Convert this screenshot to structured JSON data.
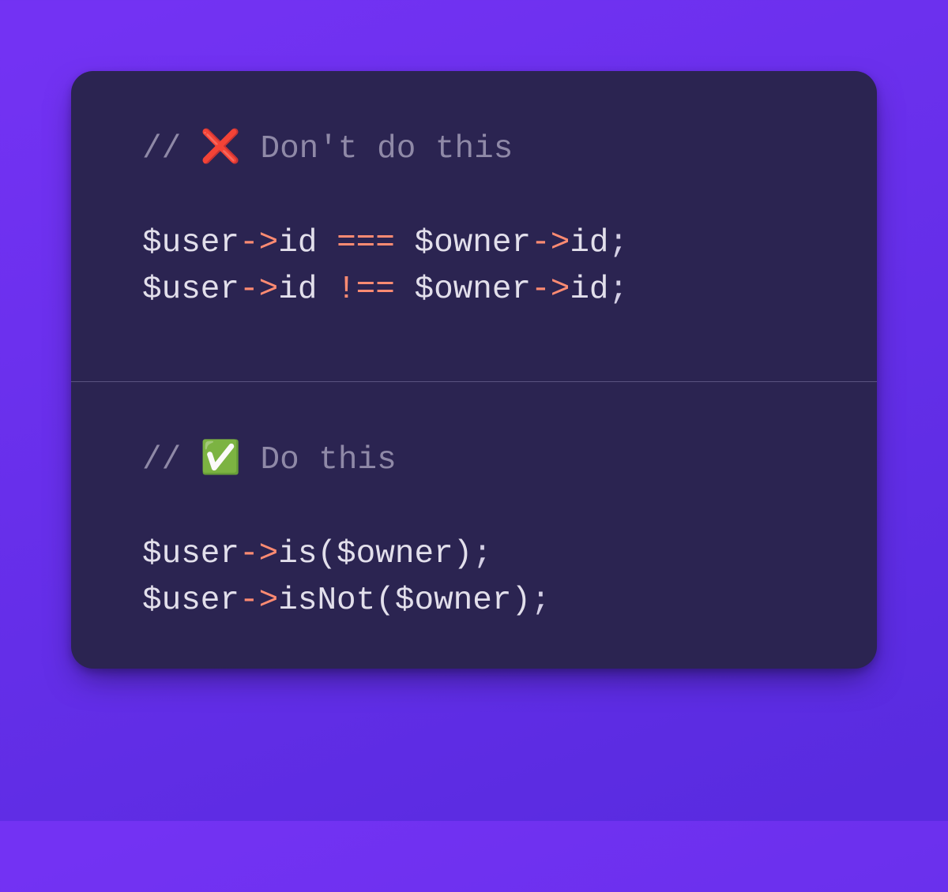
{
  "panels": [
    {
      "emoji": "❌",
      "comment_prefix": "// ",
      "comment_suffix": " Don't do this",
      "lines": [
        [
          {
            "cls": "default",
            "text": "$user"
          },
          {
            "cls": "op",
            "text": "->"
          },
          {
            "cls": "default",
            "text": "id "
          },
          {
            "cls": "op",
            "text": "==="
          },
          {
            "cls": "default",
            "text": " $owner"
          },
          {
            "cls": "op",
            "text": "->"
          },
          {
            "cls": "default",
            "text": "id"
          },
          {
            "cls": "punc",
            "text": ";"
          }
        ],
        [
          {
            "cls": "default",
            "text": "$user"
          },
          {
            "cls": "op",
            "text": "->"
          },
          {
            "cls": "default",
            "text": "id "
          },
          {
            "cls": "op",
            "text": "!=="
          },
          {
            "cls": "default",
            "text": " $owner"
          },
          {
            "cls": "op",
            "text": "->"
          },
          {
            "cls": "default",
            "text": "id"
          },
          {
            "cls": "punc",
            "text": ";"
          }
        ]
      ]
    },
    {
      "emoji": "✅",
      "comment_prefix": "// ",
      "comment_suffix": " Do this",
      "lines": [
        [
          {
            "cls": "default",
            "text": "$user"
          },
          {
            "cls": "op",
            "text": "->"
          },
          {
            "cls": "default",
            "text": "is($owner)"
          },
          {
            "cls": "punc",
            "text": ";"
          }
        ],
        [
          {
            "cls": "default",
            "text": "$user"
          },
          {
            "cls": "op",
            "text": "->"
          },
          {
            "cls": "default",
            "text": "isNot($owner)"
          },
          {
            "cls": "punc",
            "text": ";"
          }
        ]
      ]
    }
  ]
}
